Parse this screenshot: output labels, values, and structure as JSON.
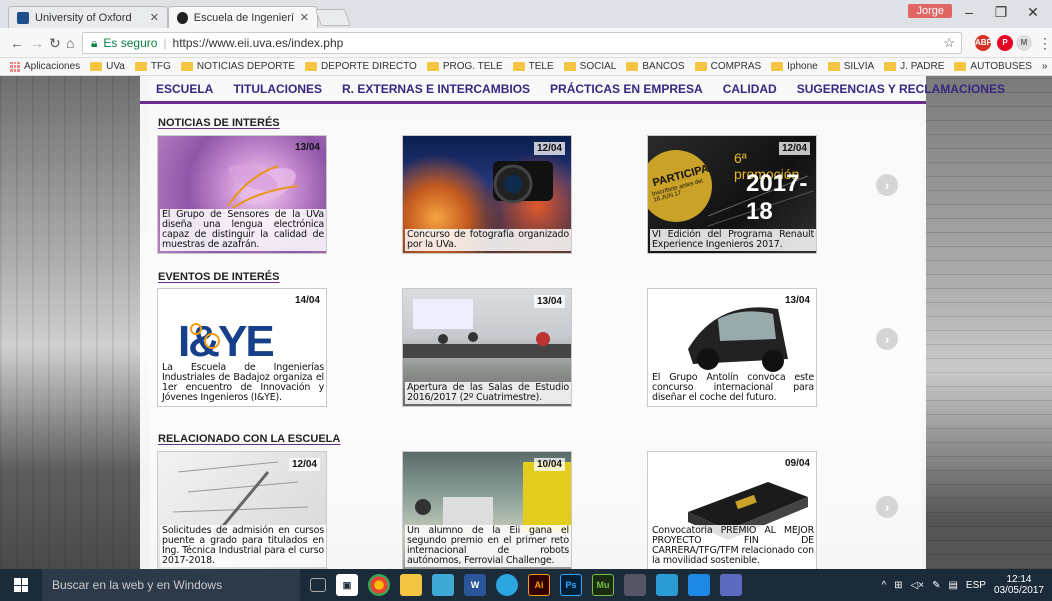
{
  "browser": {
    "tabs": [
      {
        "title": "University of Oxford",
        "close": "✕",
        "favicon_color": "#1f4e8c"
      },
      {
        "title": "Escuela de Ingenierías In",
        "close": "✕",
        "favicon_color": "#222222"
      }
    ],
    "profile_name": "Jorge",
    "secure_label": "Es seguro",
    "url": "https://www.eii.uva.es/index.php",
    "bookmarks": [
      "Aplicaciones",
      "UVa",
      "TFG",
      "NOTICIAS DEPORTE",
      "DEPORTE DIRECTO",
      "PROG. TELE",
      "TELE",
      "SOCIAL",
      "BANCOS",
      "COMPRAS",
      "Iphone",
      "SILVIA",
      "J. PADRE",
      "AUTOBUSES"
    ],
    "bookmarks_more": "»"
  },
  "nav": {
    "items": [
      "ESCUELA",
      "TITULACIONES",
      "R. EXTERNAS E INTERCAMBIOS",
      "PRÁCTICAS EN EMPRESA",
      "CALIDAD",
      "SUGERENCIAS Y RECLAMACIONES"
    ]
  },
  "sections": [
    {
      "title": "NOTICIAS DE INTERÉS",
      "cards": [
        {
          "date": "13/04",
          "caption": "El Grupo de Sensores de la UVa diseña una lengua electrónica capaz de distinguir la calidad de muestras de azafrán."
        },
        {
          "date": "12/04",
          "caption": "Concurso de fotografía organizado por la UVa."
        },
        {
          "date": "12/04",
          "caption": "VI Edición del Programa Renault Experience Ingenieros 2017.",
          "overlay": {
            "tag": "PARTICIPA",
            "sub": "Inscríbete antes del 16.JUN.17",
            "promo": "6ª promoción",
            "years": "2017-18"
          }
        }
      ]
    },
    {
      "title": "EVENTOS DE INTERÉS",
      "cards": [
        {
          "date": "14/04",
          "caption": "La Escuela de Ingenierías Industriales de Badajoz organiza el 1er encuentro de Innovación y Jóvenes Ingenieros (I&YE).",
          "logo": "I&YE"
        },
        {
          "date": "13/04",
          "caption": "Apertura de las Salas de Estudio 2016/2017 (2º Cuatrimestre)."
        },
        {
          "date": "13/04",
          "caption": "El Grupo Antolín convoca este concurso internacional para diseñar el coche del futuro."
        }
      ]
    },
    {
      "title": "RELACIONADO CON LA ESCUELA",
      "cards": [
        {
          "date": "12/04",
          "caption": "Solicitudes de admisión en cursos puente a grado para titulados en Ing. Técnica Industrial para el curso 2017-2018."
        },
        {
          "date": "10/04",
          "caption": "Un alumno de la Eii gana el segundo premio en el primer reto internacional de robots autónomos, Ferrovial Challenge."
        },
        {
          "date": "09/04",
          "caption": "Convocatoria PREMIO AL MEJOR PROYECTO FIN DE CARRERA/TFG/TFM relacionado con la movilidad sostenible."
        }
      ]
    }
  ],
  "next_arrow": "›",
  "taskbar": {
    "search_placeholder": "Buscar en la web y en Windows",
    "lang": "ESP",
    "time": "12:14",
    "date": "03/05/2017",
    "app_labels": [
      "W",
      "Ai",
      "Ps",
      "Mu"
    ]
  },
  "colors": {
    "accent": "#6b2c8f",
    "nav_text": "#3a2680"
  }
}
